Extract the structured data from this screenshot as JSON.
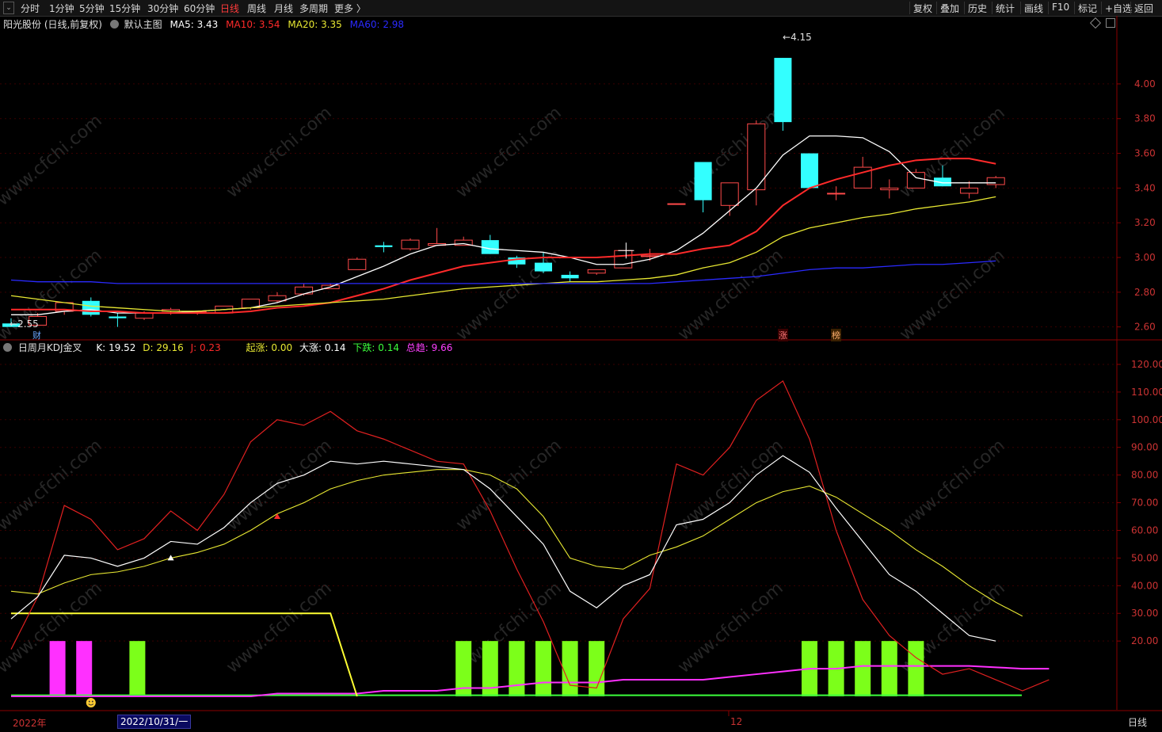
{
  "toolbar": {
    "left_items": [
      {
        "label": "分时",
        "active": false
      },
      {
        "label": "1分钟",
        "active": false
      },
      {
        "label": "5分钟",
        "active": false
      },
      {
        "label": "15分钟",
        "active": false
      },
      {
        "label": "30分钟",
        "active": false
      },
      {
        "label": "60分钟",
        "active": false
      },
      {
        "label": "日线",
        "active": true
      },
      {
        "label": "周线",
        "active": false
      },
      {
        "label": "月线",
        "active": false
      },
      {
        "label": "多周期",
        "active": false
      },
      {
        "label": "更多 〉",
        "active": false
      }
    ],
    "right_items": [
      "复权",
      "叠加",
      "历史",
      "统计",
      "画线",
      "F10",
      "标记",
      "+自选",
      "返回"
    ],
    "menu_icon": "chevron-down-icon"
  },
  "main_info": {
    "stock_name": "阳光股份 (日线,前复权)",
    "indicator_name": "默认主图",
    "ma5": {
      "label": "MA5:",
      "value": "3.43",
      "color": "#ffffff"
    },
    "ma10": {
      "label": "MA10:",
      "value": "3.54",
      "color": "#ff2a2a"
    },
    "ma20": {
      "label": "MA20:",
      "value": "3.35",
      "color": "#e8e832"
    },
    "ma60": {
      "label": "MA60:",
      "value": "2.98",
      "color": "#2a2aff"
    }
  },
  "main_chart": {
    "price_axis_ticks": [
      "4.00",
      "3.80",
      "3.60",
      "3.40",
      "3.20",
      "3.00",
      "2.80",
      "2.60"
    ],
    "price_tick_values": [
      4.0,
      3.8,
      3.6,
      3.4,
      3.2,
      3.0,
      2.8,
      2.6
    ],
    "price_range": [
      2.53,
      4.31
    ],
    "high_label": "4.15",
    "low_label": "2.55",
    "markers": [
      {
        "label": "财",
        "color": "#6aa6ff"
      },
      {
        "label": "涨",
        "color": "#ff7a7a"
      },
      {
        "label": "榜",
        "color": "#ffb070"
      }
    ],
    "candles": [
      {
        "o": 2.62,
        "h": 2.65,
        "l": 2.6,
        "c": 2.6
      },
      {
        "o": 2.61,
        "h": 2.68,
        "l": 2.61,
        "c": 2.66
      },
      {
        "o": 2.69,
        "h": 2.74,
        "l": 2.67,
        "c": 2.74
      },
      {
        "o": 2.75,
        "h": 2.77,
        "l": 2.66,
        "c": 2.67
      },
      {
        "o": 2.66,
        "h": 2.68,
        "l": 2.6,
        "c": 2.65
      },
      {
        "o": 2.65,
        "h": 2.69,
        "l": 2.64,
        "c": 2.68
      },
      {
        "o": 2.69,
        "h": 2.71,
        "l": 2.67,
        "c": 2.7
      },
      {
        "o": 2.69,
        "h": 2.69,
        "l": 2.67,
        "c": 2.69
      },
      {
        "o": 2.68,
        "h": 2.72,
        "l": 2.68,
        "c": 2.72
      },
      {
        "o": 2.71,
        "h": 2.76,
        "l": 2.7,
        "c": 2.76
      },
      {
        "o": 2.75,
        "h": 2.8,
        "l": 2.74,
        "c": 2.78
      },
      {
        "o": 2.79,
        "h": 2.85,
        "l": 2.78,
        "c": 2.83
      },
      {
        "o": 2.82,
        "h": 2.85,
        "l": 2.82,
        "c": 2.84
      },
      {
        "o": 2.93,
        "h": 3.0,
        "l": 2.93,
        "c": 2.99
      },
      {
        "o": 3.07,
        "h": 3.09,
        "l": 3.03,
        "c": 3.06
      },
      {
        "o": 3.05,
        "h": 3.11,
        "l": 3.04,
        "c": 3.1
      },
      {
        "o": 3.07,
        "h": 3.17,
        "l": 3.07,
        "c": 3.08
      },
      {
        "o": 3.07,
        "h": 3.12,
        "l": 3.07,
        "c": 3.1
      },
      {
        "o": 3.1,
        "h": 3.13,
        "l": 3.02,
        "c": 3.02
      },
      {
        "o": 3.0,
        "h": 3.01,
        "l": 2.94,
        "c": 2.96
      },
      {
        "o": 2.97,
        "h": 3.03,
        "l": 2.91,
        "c": 2.92
      },
      {
        "o": 2.9,
        "h": 2.92,
        "l": 2.86,
        "c": 2.88
      },
      {
        "o": 2.91,
        "h": 2.93,
        "l": 2.9,
        "c": 2.93
      },
      {
        "o": 2.94,
        "h": 3.04,
        "l": 2.94,
        "c": 3.04
      },
      {
        "o": 3.01,
        "h": 3.05,
        "l": 2.98,
        "c": 3.01
      },
      {
        "o": 3.31,
        "h": 3.31,
        "l": 3.31,
        "c": 3.31
      },
      {
        "o": 3.55,
        "h": 3.55,
        "l": 3.26,
        "c": 3.33
      },
      {
        "o": 3.3,
        "h": 3.43,
        "l": 3.24,
        "c": 3.43
      },
      {
        "o": 3.39,
        "h": 3.79,
        "l": 3.3,
        "c": 3.77
      },
      {
        "o": 4.15,
        "h": 4.15,
        "l": 3.73,
        "c": 3.78
      },
      {
        "o": 3.6,
        "h": 3.6,
        "l": 3.4,
        "c": 3.4
      },
      {
        "o": 3.37,
        "h": 3.41,
        "l": 3.33,
        "c": 3.37
      },
      {
        "o": 3.4,
        "h": 3.58,
        "l": 3.4,
        "c": 3.52
      },
      {
        "o": 3.39,
        "h": 3.45,
        "l": 3.34,
        "c": 3.4
      },
      {
        "o": 3.4,
        "h": 3.51,
        "l": 3.4,
        "c": 3.49
      },
      {
        "o": 3.46,
        "h": 3.53,
        "l": 3.41,
        "c": 3.41
      },
      {
        "o": 3.37,
        "h": 3.44,
        "l": 3.34,
        "c": 3.4
      },
      {
        "o": 3.42,
        "h": 3.47,
        "l": 3.4,
        "c": 3.46
      }
    ],
    "ma_series": [
      {
        "name": "MA5",
        "color": "#ffffff",
        "start": 0,
        "values": [
          2.67,
          2.67,
          2.69,
          2.7,
          2.68,
          2.68,
          2.68,
          2.69,
          2.7,
          2.71,
          2.74,
          2.79,
          2.83,
          2.89,
          2.95,
          3.02,
          3.07,
          3.08,
          3.05,
          3.04,
          3.03,
          3.0,
          2.96,
          2.96,
          2.99,
          3.04,
          3.14,
          3.27,
          3.4,
          3.59,
          3.7,
          3.7,
          3.69,
          3.61,
          3.46,
          3.43,
          3.43,
          3.43
        ]
      },
      {
        "name": "MA10",
        "color": "#ff2a2a",
        "start": 0,
        "values": [
          2.7,
          2.7,
          2.7,
          2.69,
          2.69,
          2.68,
          2.68,
          2.68,
          2.68,
          2.69,
          2.71,
          2.72,
          2.74,
          2.78,
          2.82,
          2.87,
          2.91,
          2.95,
          2.97,
          2.99,
          3.0,
          3.0,
          3.0,
          3.01,
          3.02,
          3.02,
          3.05,
          3.07,
          3.15,
          3.3,
          3.4,
          3.45,
          3.49,
          3.53,
          3.56,
          3.57,
          3.57,
          3.54
        ]
      },
      {
        "name": "MA20",
        "color": "#e8e832",
        "start": 0,
        "values": [
          2.78,
          2.76,
          2.74,
          2.72,
          2.71,
          2.7,
          2.69,
          2.69,
          2.7,
          2.71,
          2.72,
          2.73,
          2.74,
          2.75,
          2.76,
          2.78,
          2.8,
          2.82,
          2.83,
          2.84,
          2.85,
          2.86,
          2.86,
          2.87,
          2.88,
          2.9,
          2.94,
          2.97,
          3.03,
          3.12,
          3.17,
          3.2,
          3.23,
          3.25,
          3.28,
          3.3,
          3.32,
          3.35
        ]
      },
      {
        "name": "MA60",
        "color": "#2a2aff",
        "start": 0,
        "values": [
          2.87,
          2.86,
          2.86,
          2.86,
          2.85,
          2.85,
          2.85,
          2.85,
          2.85,
          2.85,
          2.85,
          2.85,
          2.85,
          2.85,
          2.85,
          2.85,
          2.85,
          2.85,
          2.85,
          2.85,
          2.85,
          2.85,
          2.85,
          2.85,
          2.85,
          2.86,
          2.87,
          2.88,
          2.89,
          2.91,
          2.93,
          2.94,
          2.94,
          2.95,
          2.96,
          2.96,
          2.97,
          2.98
        ]
      }
    ]
  },
  "kdj_info": {
    "title": "日周月KDJ金叉",
    "k": {
      "label": "K:",
      "value": "19.52",
      "color": "#ffffff"
    },
    "d": {
      "label": "D:",
      "value": "29.16",
      "color": "#e8e832"
    },
    "j": {
      "label": "J:",
      "value": "0.23",
      "color": "#ff2a2a"
    },
    "qizhang": {
      "label": "起涨:",
      "value": "0.00",
      "color": "#e8e832"
    },
    "dazhang": {
      "label": "大涨:",
      "value": "0.14",
      "color": "#ffffff"
    },
    "xiadie": {
      "label": "下跌:",
      "value": "0.14",
      "color": "#3cff3c"
    },
    "zongqu": {
      "label": "总趋:",
      "value": "9.66",
      "color": "#ff40ff"
    }
  },
  "kdj_chart": {
    "axis_ticks": [
      "120.00",
      "110.00",
      "100.00",
      "90.00",
      "80.00",
      "70.00",
      "60.00",
      "50.00",
      "40.00",
      "30.00",
      "20.00"
    ],
    "axis_tick_values": [
      120,
      110,
      100,
      90,
      80,
      70,
      60,
      50,
      40,
      30,
      20
    ],
    "value_range": [
      0,
      124
    ],
    "k_values": [
      28,
      36,
      51,
      50,
      47,
      50,
      56,
      55,
      61,
      70,
      77,
      80,
      85,
      84,
      85,
      84,
      83,
      82,
      75,
      65,
      55,
      38,
      32,
      40,
      44,
      62,
      64,
      70,
      80,
      87,
      81,
      68,
      56,
      44,
      38,
      30,
      22,
      20
    ],
    "d_values": [
      38,
      37,
      41,
      44,
      45,
      47,
      50,
      52,
      55,
      60,
      66,
      70,
      75,
      78,
      80,
      81,
      82,
      82,
      80,
      75,
      65,
      50,
      47,
      46,
      51,
      54,
      58,
      64,
      70,
      74,
      76,
      72,
      66,
      60,
      53,
      47,
      40,
      34,
      29
    ],
    "j_values": [
      17,
      36,
      69,
      64,
      53,
      57,
      67,
      60,
      73,
      92,
      100,
      98,
      103,
      96,
      93,
      89,
      85,
      84,
      67,
      46,
      27,
      4,
      3,
      28,
      39,
      84,
      80,
      90,
      107,
      114,
      93,
      60,
      35,
      22,
      14,
      8,
      10,
      6,
      2,
      6
    ],
    "yellow_step": [
      {
        "x": 0,
        "v": 30
      },
      {
        "x": 12,
        "v": 30
      },
      {
        "x": 13,
        "v": 0
      }
    ],
    "magenta_values": [
      0,
      0,
      0,
      0,
      0,
      0,
      0,
      0,
      0,
      0,
      1,
      1,
      1,
      1,
      2,
      2,
      2,
      3,
      3,
      4,
      5,
      5,
      5,
      6,
      6,
      6,
      6,
      7,
      8,
      9,
      10,
      10,
      11,
      11,
      11,
      11,
      11,
      10.5,
      10,
      10
    ],
    "green_baseline": 0.4,
    "bars": [
      {
        "i": 1,
        "color": "#ff30ff"
      },
      {
        "i": 2,
        "color": "#ff30ff"
      },
      {
        "i": 4,
        "color": "#7cff1a"
      },
      {
        "i": 17,
        "color": "#7cff1a"
      },
      {
        "i": 18,
        "color": "#7cff1a"
      },
      {
        "i": 19,
        "color": "#7cff1a"
      },
      {
        "i": 20,
        "color": "#7cff1a"
      },
      {
        "i": 21,
        "color": "#7cff1a"
      },
      {
        "i": 22,
        "color": "#7cff1a"
      },
      {
        "i": 30,
        "color": "#7cff1a"
      },
      {
        "i": 31,
        "color": "#7cff1a"
      },
      {
        "i": 32,
        "color": "#7cff1a"
      },
      {
        "i": 33,
        "color": "#7cff1a"
      },
      {
        "i": 34,
        "color": "#7cff1a"
      }
    ],
    "bar_height_value": 20,
    "signal_markers": [
      {
        "i": 6,
        "v": 50,
        "color": "#ffffff"
      },
      {
        "i": 10,
        "v": 65,
        "color": "#ff2a2a"
      }
    ],
    "smiley_index": 3
  },
  "date_axis": {
    "year_label": "2022年",
    "cursor_date": "2022/10/31/一",
    "month_label": "12",
    "period_label": "日线"
  },
  "watermark_text": "www.cfchi.com",
  "colors": {
    "up": "#ff4a4a",
    "down": "#33ffff",
    "axis": "#8b0000",
    "grid": "#3a0000"
  }
}
